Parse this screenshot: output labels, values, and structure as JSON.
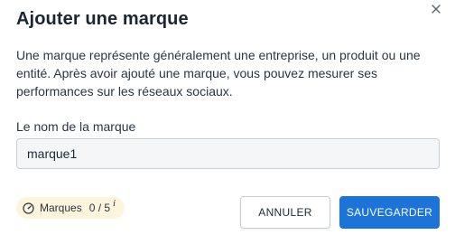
{
  "dialog": {
    "title": "Ajouter une marque",
    "close_icon": "close-icon",
    "description": "Une marque représente généralement une entreprise, un produit ou une entité. Après avoir ajouté une marque, vous pouvez mesurer ses performances sur les réseaux sociaux."
  },
  "form": {
    "brand_name_label": "Le nom de la marque",
    "brand_name_value": "marque1"
  },
  "usage": {
    "icon": "gauge-icon",
    "label": "Marques",
    "count": "0 / 5",
    "info": "i"
  },
  "actions": {
    "cancel_label": "ANNULER",
    "save_label": "SAUVEGARDER"
  },
  "colors": {
    "primary": "#1d74d8",
    "badge_background": "#fdf4dc",
    "input_background": "#f5f6f8"
  }
}
